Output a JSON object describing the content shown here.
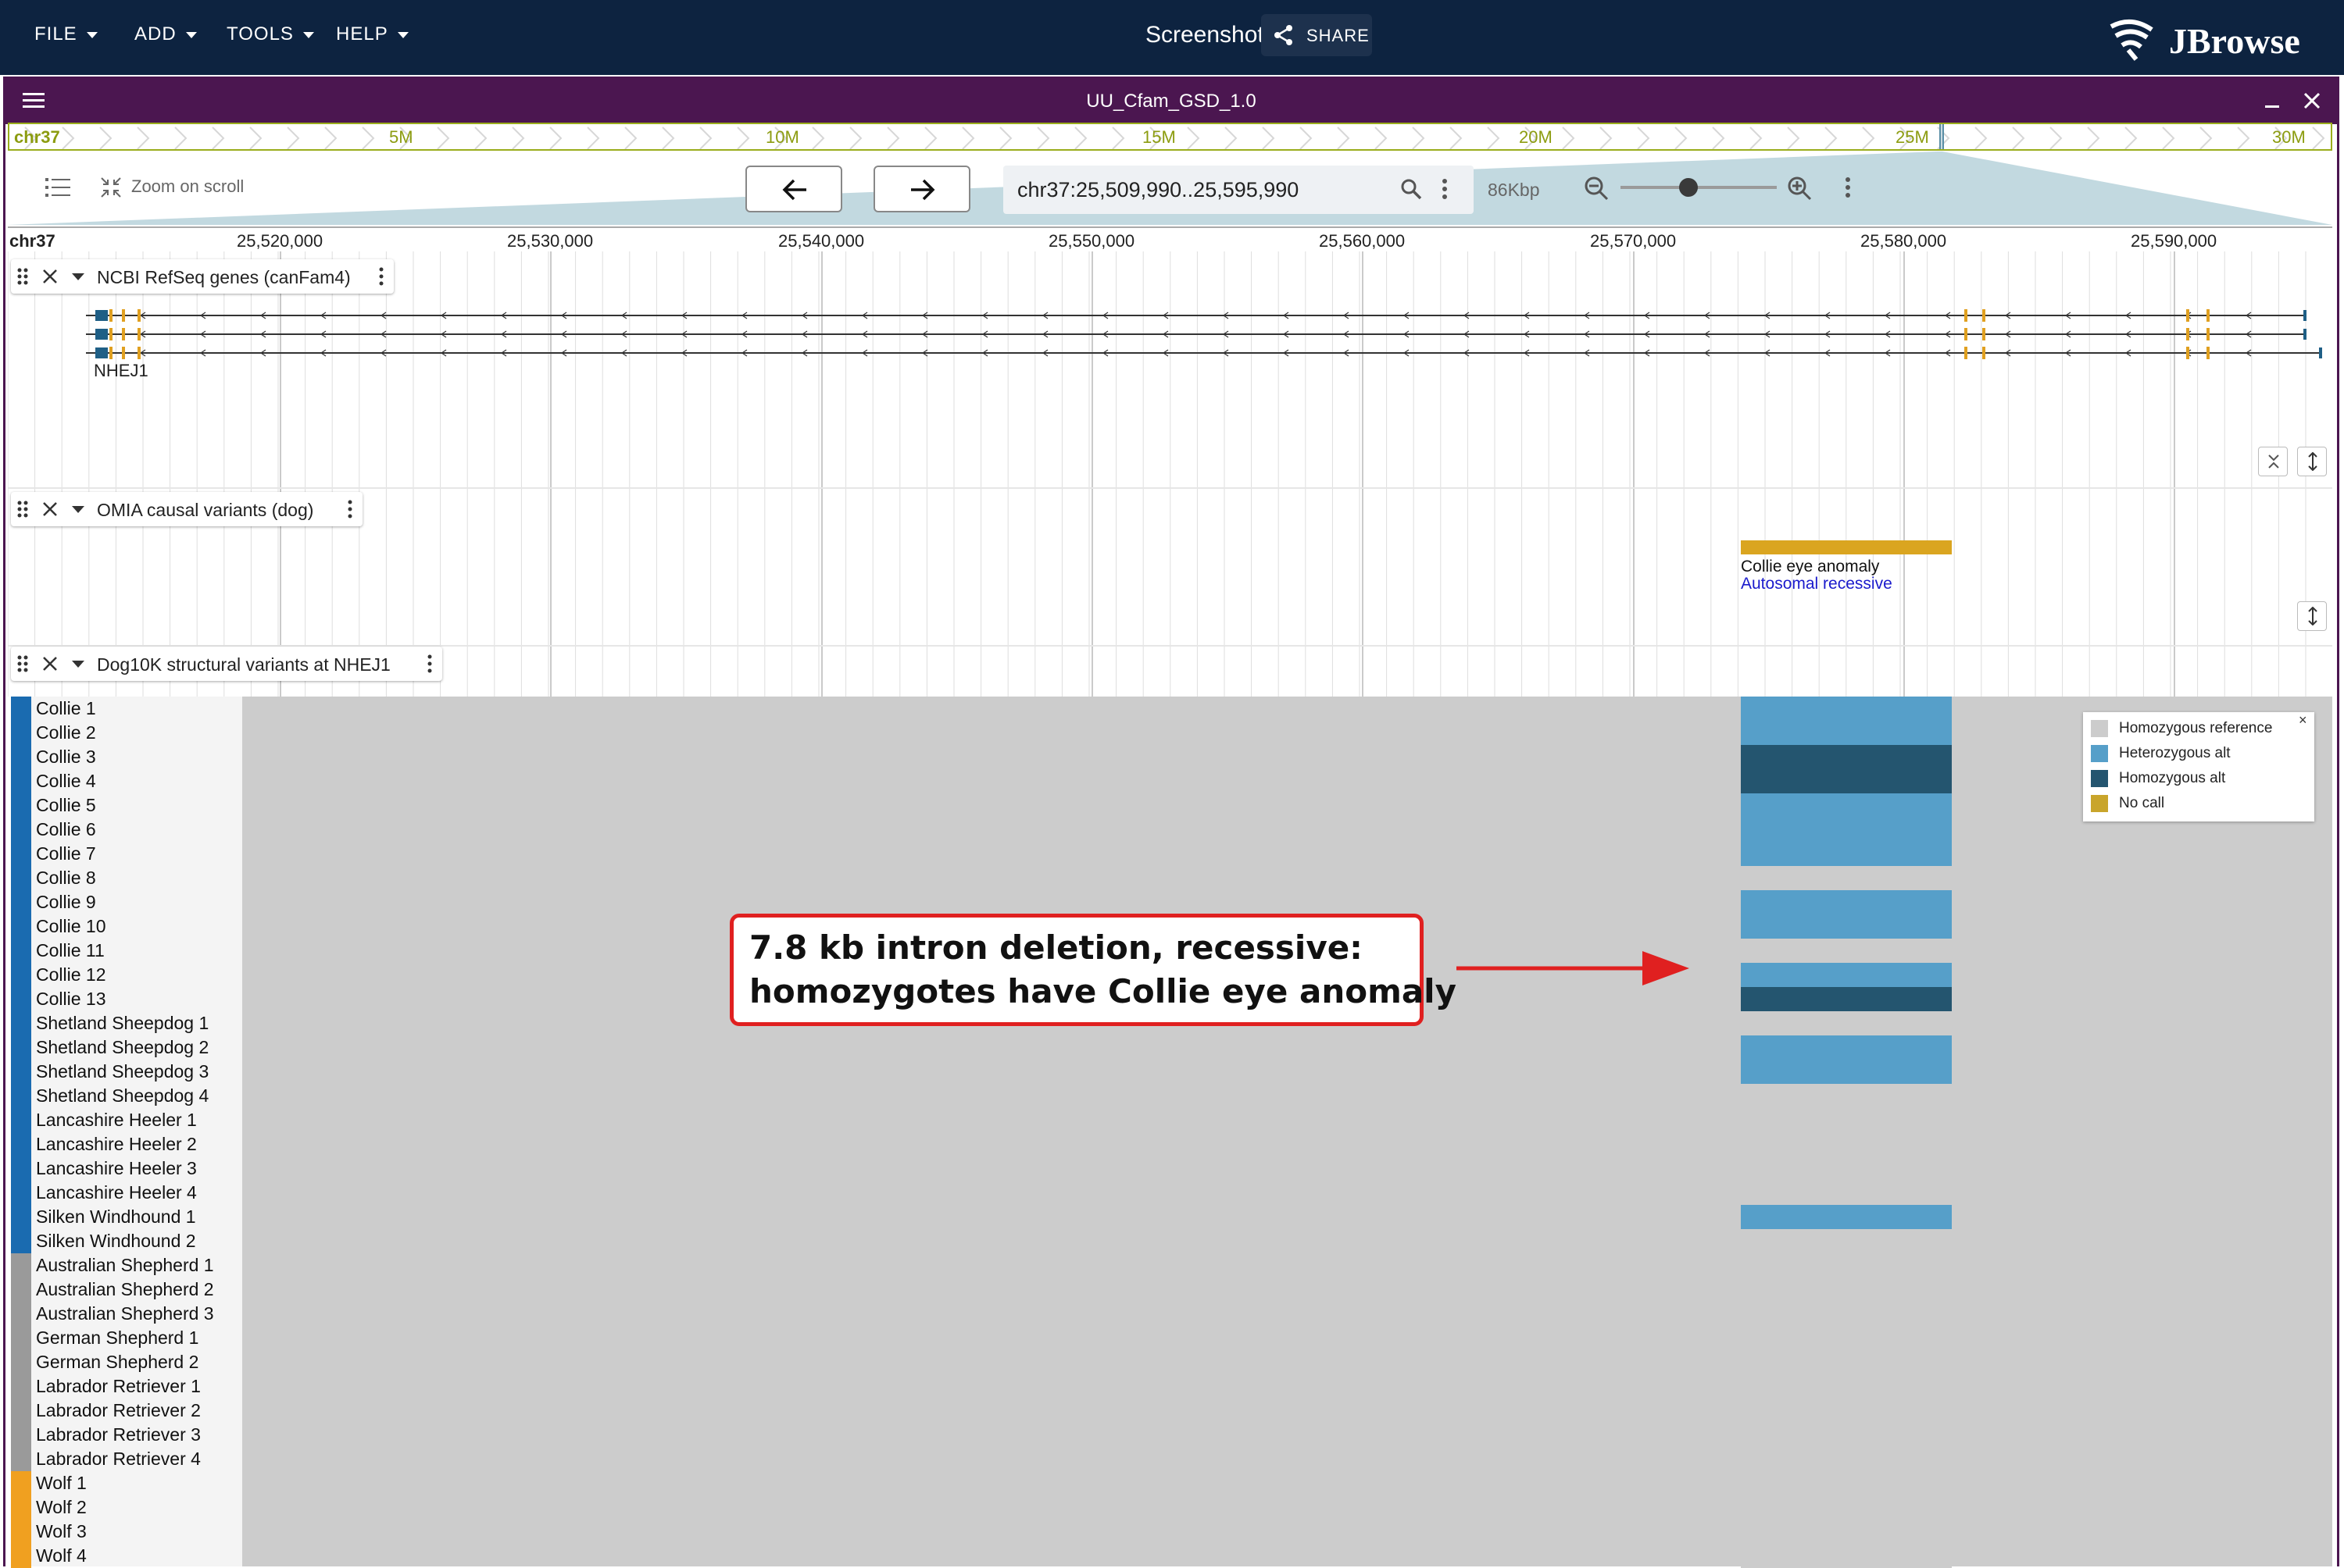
{
  "appbar": {
    "menus": [
      "FILE",
      "ADD",
      "TOOLS",
      "HELP"
    ],
    "screenshot_title": "Screenshot",
    "share_label": "SHARE",
    "logo_text": "JBrowse"
  },
  "view": {
    "title": "UU_Cfam_GSD_1.0",
    "overview": {
      "chrom": "chr37",
      "ticks": [
        "5M",
        "10M",
        "15M",
        "20M",
        "25M",
        "30M"
      ]
    },
    "toolbar": {
      "zoom_on_scroll_label": "Zoom on scroll",
      "location": "chr37:25,509,990..25,595,990",
      "zoom_label": "86Kbp"
    },
    "ruler": {
      "chrom": "chr37",
      "labels": [
        "25,520,000",
        "25,530,000",
        "25,540,000",
        "25,550,000",
        "25,560,000",
        "25,570,000",
        "25,580,000",
        "25,590,000"
      ]
    }
  },
  "tracks": [
    {
      "name": "NCBI RefSeq genes (canFam4)",
      "gene_label": "NHEJ1"
    },
    {
      "name": "OMIA causal variants (dog)",
      "feature_label": "Collie eye anomaly",
      "feature_sublabel": "Autosomal recessive"
    },
    {
      "name": "Dog10K structural variants at NHEJ1"
    }
  ],
  "samples": [
    "Collie 1",
    "Collie 2",
    "Collie 3",
    "Collie 4",
    "Collie 5",
    "Collie 6",
    "Collie 7",
    "Collie 8",
    "Collie 9",
    "Collie 10",
    "Collie 11",
    "Collie 12",
    "Collie 13",
    "Shetland Sheepdog 1",
    "Shetland Sheepdog 2",
    "Shetland Sheepdog 3",
    "Shetland Sheepdog 4",
    "Lancashire Heeler 1",
    "Lancashire Heeler 2",
    "Lancashire Heeler 3",
    "Lancashire Heeler 4",
    "Silken Windhound 1",
    "Silken Windhound 2",
    "Australian Shepherd 1",
    "Australian Shepherd 2",
    "Australian Shepherd 3",
    "German Shepherd 1",
    "German Shepherd 2",
    "Labrador Retriever 1",
    "Labrador Retriever 2",
    "Labrador Retriever 3",
    "Labrador Retriever 4",
    "Wolf 1",
    "Wolf 2",
    "Wolf 3",
    "Wolf 4"
  ],
  "sample_groups": [
    {
      "count": 23,
      "color": "#1a6bb0"
    },
    {
      "count": 9,
      "color": "#9a9a9a"
    },
    {
      "count": 4,
      "color": "#f0a020"
    }
  ],
  "genotypes": [
    "het",
    "het",
    "hom",
    "hom",
    "het",
    "het",
    "het",
    "ref",
    "het",
    "het",
    "ref",
    "het",
    "hom",
    "ref",
    "het",
    "het",
    "ref",
    "ref",
    "ref",
    "ref",
    "ref",
    "het",
    "ref",
    "ref",
    "ref",
    "ref",
    "ref",
    "ref",
    "ref",
    "ref",
    "ref",
    "ref",
    "ref",
    "ref",
    "ref",
    "ref"
  ],
  "genotypes_note_hidden": "",
  "legend": {
    "close": "×",
    "items": [
      {
        "label": "Homozygous reference",
        "color": "#cccccc"
      },
      {
        "label": "Heterozygous alt",
        "color": "#569fc9"
      },
      {
        "label": "Homozygous alt",
        "color": "#24556f"
      },
      {
        "label": "No call",
        "color": "#c9a52b"
      }
    ]
  },
  "callout": {
    "line1": "7.8 kb intron deletion, recessive:",
    "line2": "homozygotes have Collie eye anomaly"
  },
  "colors": {
    "appbar": "#0d2340",
    "view_header": "#4b1650",
    "overview_accent": "#9aad1c",
    "exon": "#e0a020",
    "utr": "#1f5f86",
    "omia_feature": "#daa520",
    "callout": "#e02020"
  }
}
